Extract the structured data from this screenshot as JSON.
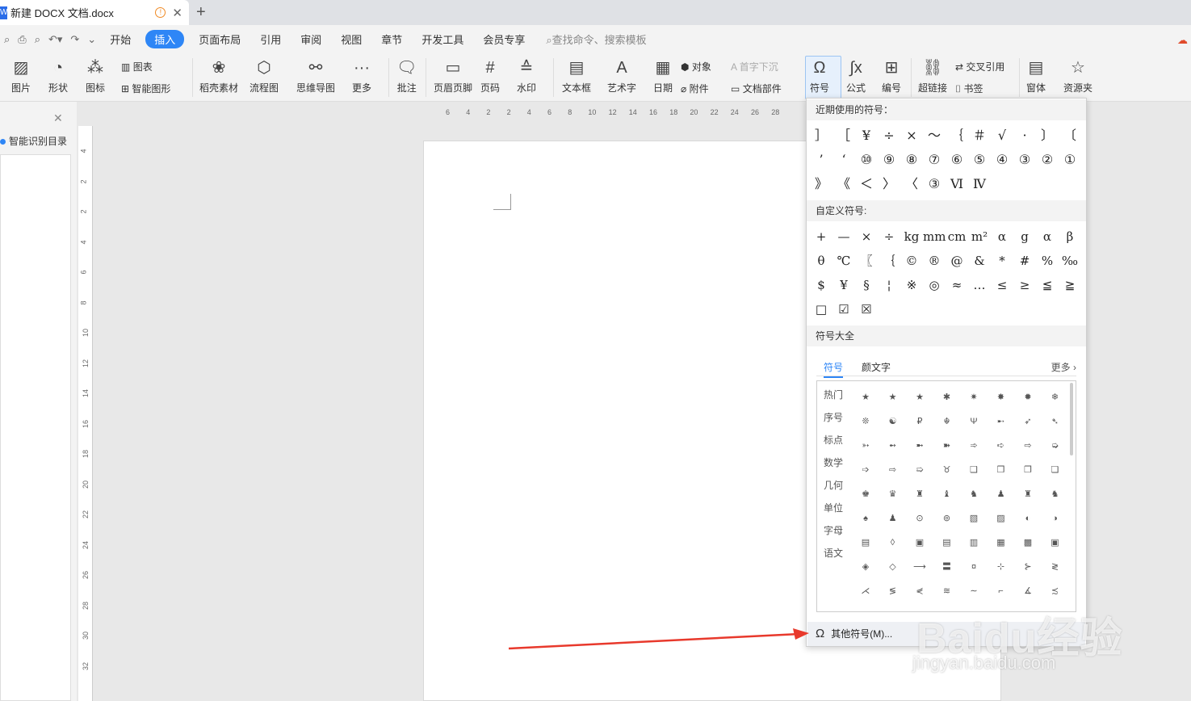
{
  "tab": {
    "title": "新建 DOCX 文档.docx"
  },
  "menu": [
    "开始",
    "插入",
    "页面布局",
    "引用",
    "审阅",
    "视图",
    "章节",
    "开发工具",
    "会员专享"
  ],
  "menu_active_index": 1,
  "search": "查找命令、搜索模板",
  "ribbon": {
    "picture": "图片",
    "shape": "形状",
    "icon": "图标",
    "chart": "图表",
    "smart": "智能图形",
    "daoke": "稻壳素材",
    "flow": "流程图",
    "mind": "思维导图",
    "more": "更多",
    "comment": "批注",
    "header": "页眉页脚",
    "pagenum": "页码",
    "watermark": "水印",
    "textbox": "文本框",
    "arttext": "艺术字",
    "date": "日期",
    "object": "对象",
    "attach": "附件",
    "dropcap": "首字下沉",
    "docpart": "文档部件",
    "symbol": "符号",
    "formula": "公式",
    "numbering": "编号",
    "hyperlink": "超链接",
    "crossref": "交叉引用",
    "bookmark": "书签",
    "window": "窗体",
    "resource": "资源夹"
  },
  "nav": {
    "title": "智能识别目录"
  },
  "hruler_labels": [
    "6",
    "4",
    "2",
    "2",
    "4",
    "6",
    "8",
    "10",
    "12",
    "14",
    "16",
    "18",
    "20",
    "22",
    "24",
    "26",
    "28"
  ],
  "vruler_labels": [
    "4",
    "2",
    "2",
    "4",
    "6",
    "8",
    "10",
    "12",
    "14",
    "16",
    "18",
    "20",
    "22",
    "24",
    "26",
    "28",
    "30",
    "32"
  ],
  "popup": {
    "recent_title": "近期使用的符号：",
    "recent": [
      "］",
      "［",
      "¥",
      "÷",
      "×",
      "～",
      "｛",
      "＃",
      "√",
      "·",
      "〕",
      "〔",
      "’",
      "‘",
      "⑩",
      "⑨",
      "⑧",
      "⑦",
      "⑥",
      "⑤",
      "④",
      "③",
      "②",
      "①",
      "》",
      "《",
      "＜",
      "〉",
      "〈",
      "③",
      "Ⅵ",
      "Ⅳ"
    ],
    "custom_title": "自定义符号:",
    "custom": [
      "+",
      "—",
      "×",
      "÷",
      "kg",
      "mm",
      "cm",
      "m²",
      "α",
      "g",
      "α",
      "β",
      "θ",
      "℃",
      "〖",
      "｛",
      "©",
      "®",
      "@",
      "&",
      "*",
      "#",
      "%",
      "‰",
      "$",
      "¥",
      "§",
      "¦",
      "※",
      "◎",
      "≈",
      "…",
      "≤",
      "≥",
      "≦",
      "≧",
      "□",
      "☑",
      "☒"
    ],
    "all_title": "符号大全",
    "tab_symbol": "符号",
    "tab_emoticon": "颜文字",
    "more": "更多",
    "categories": [
      "热门",
      "序号",
      "标点",
      "数学",
      "几何",
      "单位",
      "字母",
      "语文"
    ],
    "grid": [
      "★",
      "★",
      "★",
      "✱",
      "✷",
      "✸",
      "✹",
      "❄",
      "❊",
      "☯",
      "₽",
      "☬",
      "Ψ",
      "➸",
      "➶",
      "➴",
      "➳",
      "➻",
      "➼",
      "➽",
      "➾",
      "➪",
      "⇨",
      "➭",
      "➩",
      "⇨",
      "➯",
      "♉",
      "❑",
      "❒",
      "❐",
      "❏",
      "♚",
      "♛",
      "♜",
      "♝",
      "♞",
      "♟",
      "♜",
      "♞",
      "♠",
      "♟",
      "⊙",
      "⊚",
      "▧",
      "▨",
      "◐",
      "◑",
      "▤",
      "◊",
      "▣",
      "▤",
      "▥",
      "▦",
      "▩",
      "▣",
      "◈",
      "◇",
      "⟶",
      "〓",
      "¤",
      "⊹",
      "⊱",
      "≷",
      "⋌",
      "≶",
      "⋞",
      "≋",
      "∼",
      "⌐",
      "∡",
      "≾"
    ],
    "other": "其他符号(M)..."
  },
  "watermark": {
    "brand": "Baidu经验",
    "url": "jingyan.baidu.com"
  },
  "colors": {
    "accent": "#2e86f6",
    "arrow": "#e8392c"
  }
}
